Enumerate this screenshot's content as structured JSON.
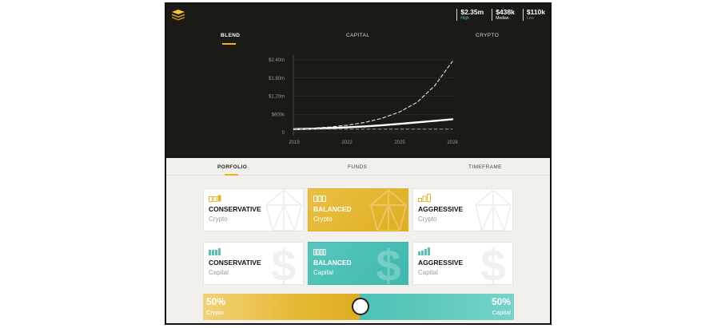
{
  "stats": [
    {
      "value": "$2.35m",
      "label": "High",
      "kind": "high"
    },
    {
      "value": "$438k",
      "label": "Median",
      "kind": "median"
    },
    {
      "value": "$110k",
      "label": "Low",
      "kind": "low"
    }
  ],
  "top_tabs": [
    "BLEND",
    "CAPITAL",
    "CRYPTO"
  ],
  "active_top_tab": "BLEND",
  "bottom_tabs": [
    "PORFOLIO",
    "FUNDS",
    "TIMEFRAME"
  ],
  "active_bottom_tab": "PORFOLIO",
  "chart_data": {
    "type": "line",
    "x": [
      2019,
      2020,
      2021,
      2022,
      2023,
      2024,
      2025,
      2026,
      2027,
      2028
    ],
    "xticks": [
      "2019",
      "2022",
      "2025",
      "2028"
    ],
    "yticks": [
      "0",
      "$600k",
      "$1.20m",
      "$1.80m",
      "$2.40m"
    ],
    "ylim": [
      0,
      2400000
    ],
    "grid": true,
    "series": [
      {
        "style": "dashed-upper",
        "values": [
          110000,
          140000,
          180000,
          240000,
          330000,
          470000,
          680000,
          1000000,
          1550000,
          2350000
        ]
      },
      {
        "style": "solid-median",
        "values": [
          110000,
          125000,
          145000,
          170000,
          200000,
          240000,
          285000,
          335000,
          385000,
          438000
        ]
      },
      {
        "style": "dashed-lower",
        "values": [
          110000,
          110000,
          110000,
          110000,
          110000,
          110000,
          110000,
          110000,
          110000,
          110000
        ]
      }
    ]
  },
  "crypto_cards": [
    {
      "title": "CONSERVATIVE",
      "sub": "Crypto",
      "selected": false
    },
    {
      "title": "BALANCED",
      "sub": "Crypto",
      "selected": true
    },
    {
      "title": "AGGRESSIVE",
      "sub": "Crypto",
      "selected": false
    }
  ],
  "capital_cards": [
    {
      "title": "CONSERVATIVE",
      "sub": "Capital",
      "selected": false
    },
    {
      "title": "BALANCED",
      "sub": "Capital",
      "selected": true
    },
    {
      "title": "AGGRESSIVE",
      "sub": "Capital",
      "selected": false
    }
  ],
  "slider": {
    "left_pct": "50%",
    "left_label": "Crypto",
    "right_pct": "50%",
    "right_label": "Capital",
    "split": 0.5
  },
  "colors": {
    "gold": "#e7b52d",
    "teal": "#4fc1b6",
    "dark_bg": "#1c1a17"
  }
}
